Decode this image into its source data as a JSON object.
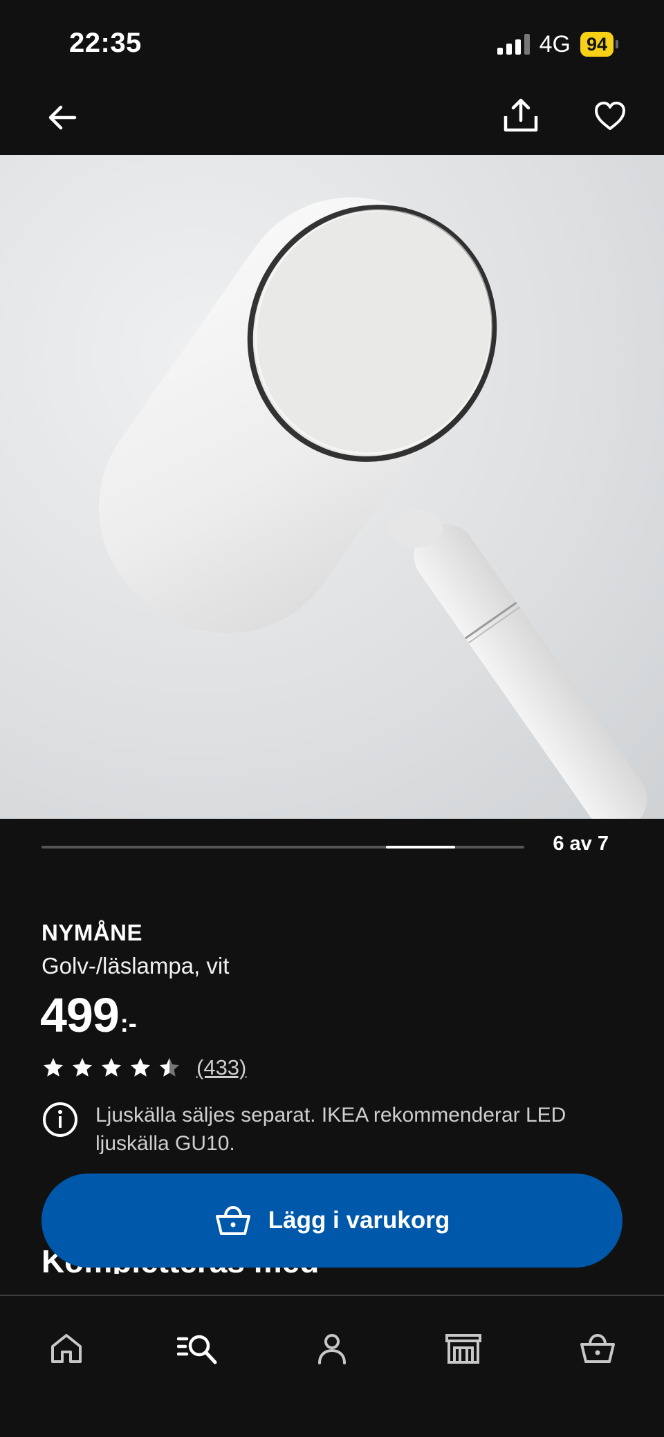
{
  "status_bar": {
    "time": "22:35",
    "network": "4G",
    "battery": "94",
    "battery_color": "#f7d117"
  },
  "top_nav": {
    "back_icon": "arrow-left-icon",
    "share_icon": "share-icon",
    "favorite_icon": "heart-icon"
  },
  "product_image": {
    "depicts": "white lamp head close-up"
  },
  "carousel": {
    "counter": "6 av 7",
    "current": 6,
    "total": 7
  },
  "product": {
    "name": "NYMÅNE",
    "description": "Golv-/läslampa, vit",
    "price": "499",
    "price_suffix": ":-",
    "rating": 4.5,
    "review_count": "(433)",
    "info_text": "Ljuskälla säljes separat. IKEA rekommenderar LED ljuskälla GU10."
  },
  "section": {
    "heading": "Kompletteras med"
  },
  "cart_button": {
    "label": "Lägg i varukorg",
    "color": "#0058ab"
  },
  "bottom_nav": {
    "tabs": [
      "home-icon",
      "search-icon",
      "profile-icon",
      "store-icon",
      "cart-icon"
    ]
  }
}
